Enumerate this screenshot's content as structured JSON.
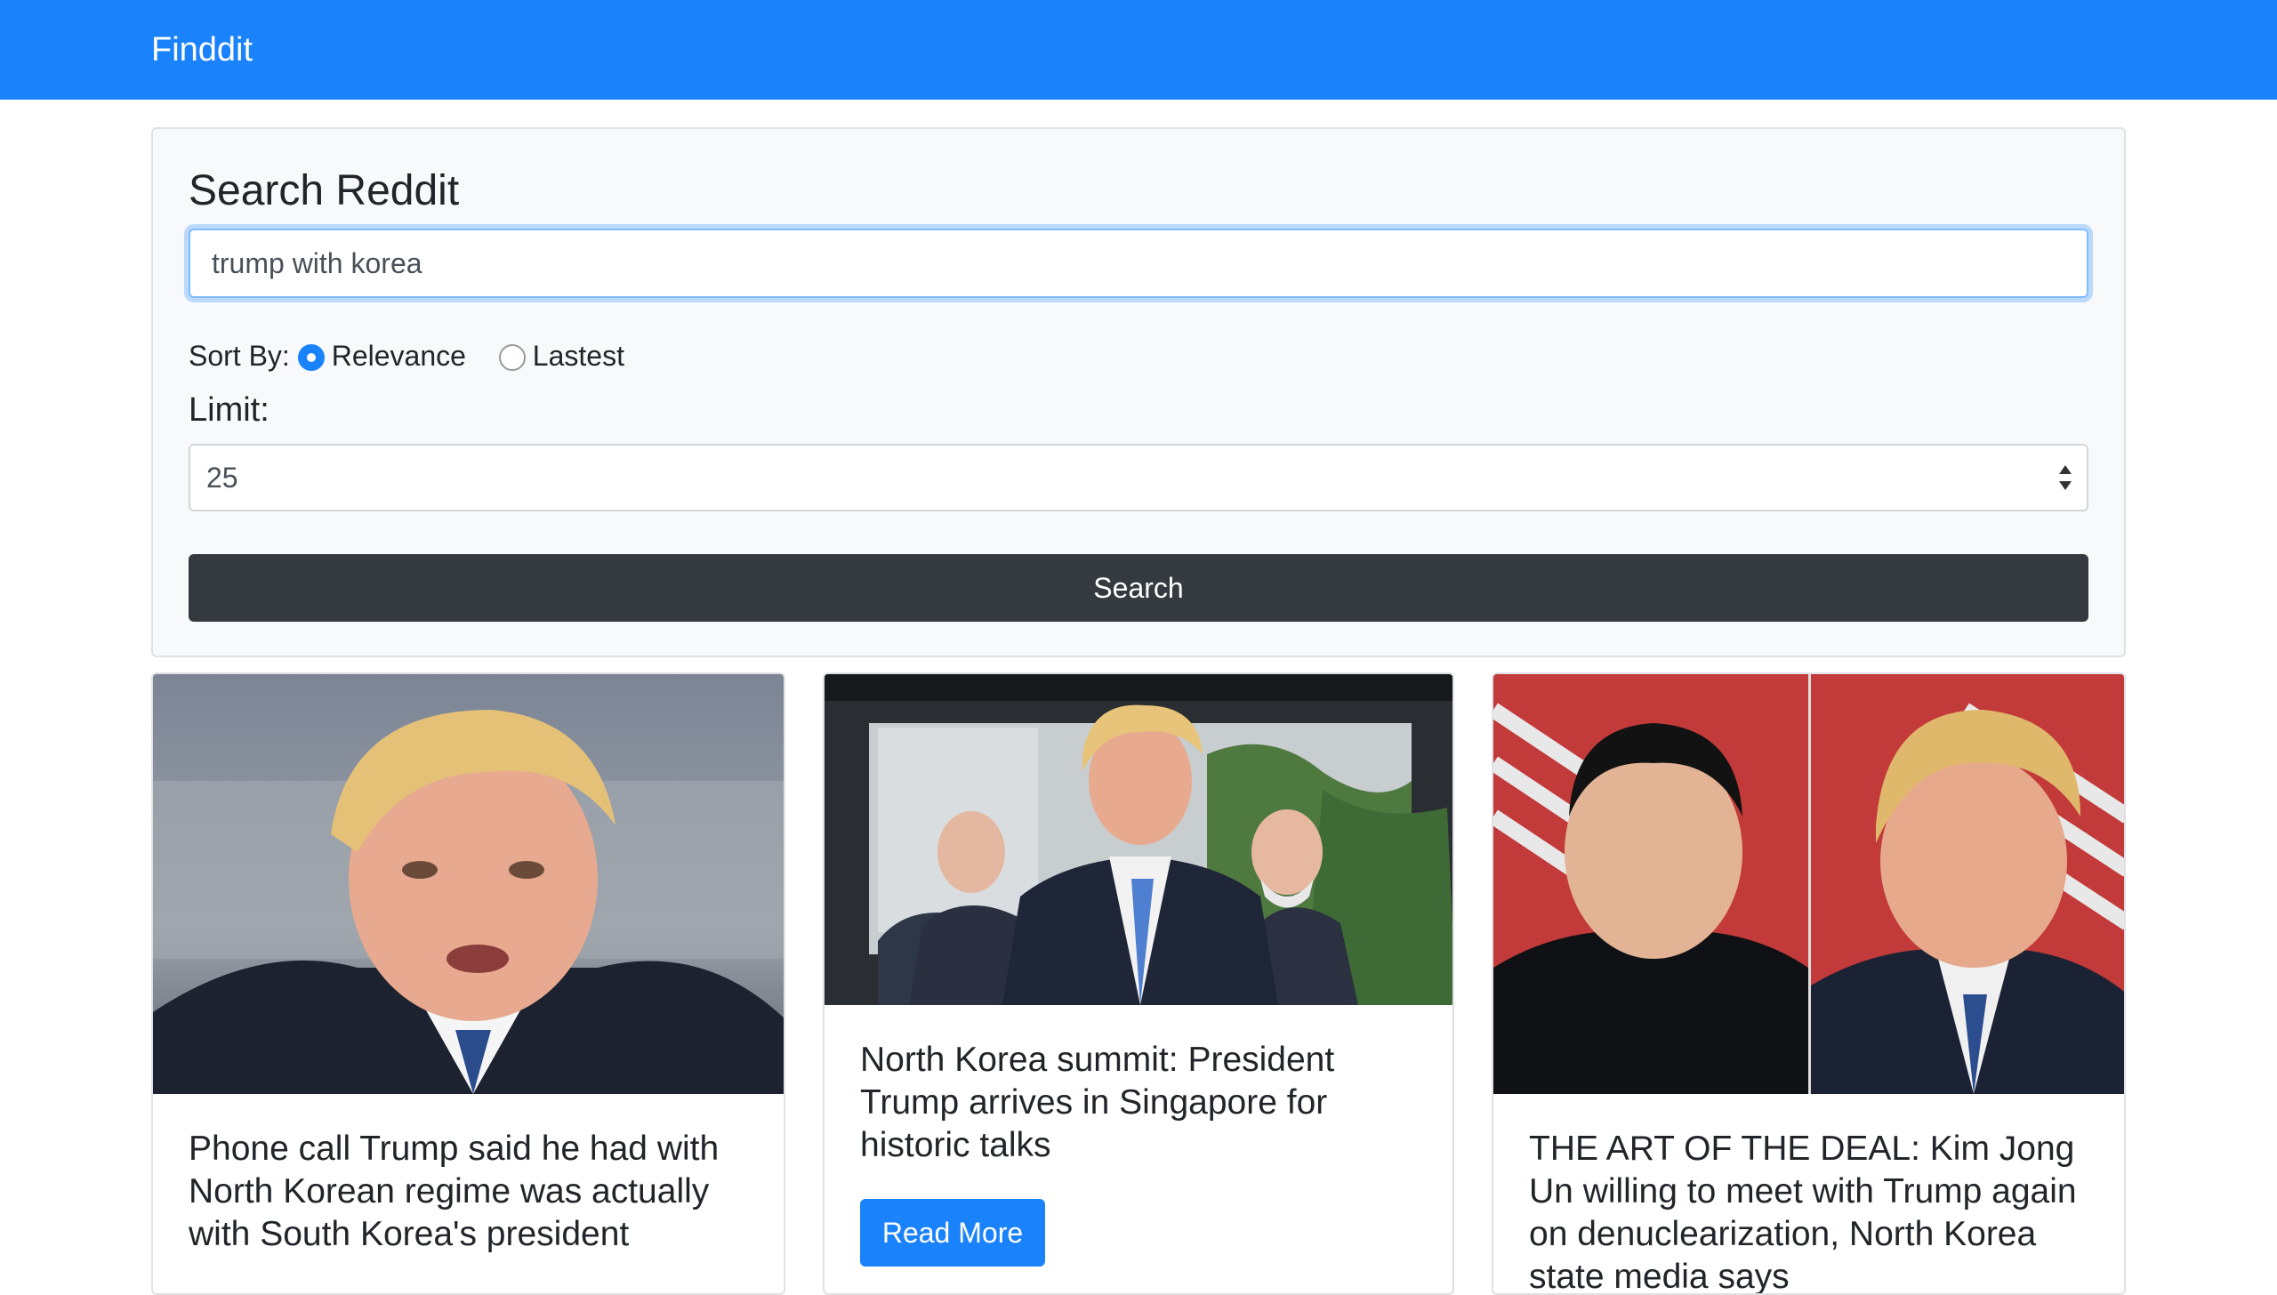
{
  "app": {
    "brand": "Finddit"
  },
  "search": {
    "title": "Search Reddit",
    "query_value": "trump with korea",
    "sort_label": "Sort By:",
    "sort_options": [
      {
        "label": "Relevance",
        "checked": true
      },
      {
        "label": "Lastest",
        "checked": false
      }
    ],
    "limit_label": "Limit:",
    "limit_value": "25",
    "button_label": "Search"
  },
  "results": [
    {
      "image": "trump-portrait-photo",
      "title": "Phone call Trump said he had with North Korean regime was actually with South Korea's president"
    },
    {
      "image": "singapore-summit-photo",
      "title": "North Korea summit: President Trump arrives in Singapore for historic talks",
      "button_label": "Read More"
    },
    {
      "image": "kim-trump-split-photo",
      "title": "THE ART OF THE DEAL: Kim Jong Un willing to meet with Trump again on denuclearization, North Korea state media says"
    }
  ],
  "colors": {
    "primary": "#1a82fb",
    "dark_button": "#343a40",
    "card_bg": "#f8f9fa",
    "text": "#212529"
  }
}
